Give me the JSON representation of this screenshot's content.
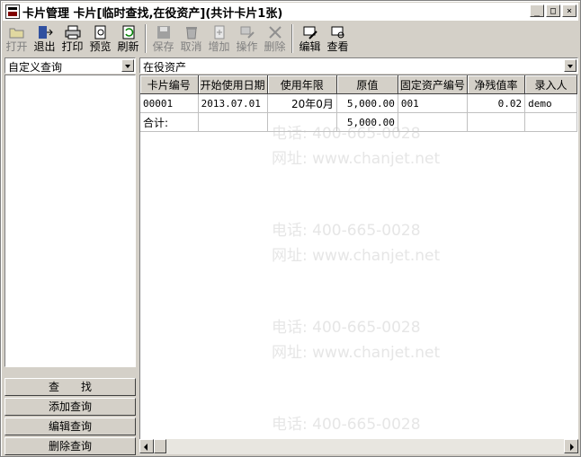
{
  "window": {
    "title": "卡片管理  卡片[临时查找,在役资产](共计卡片1张)",
    "min": "_",
    "max": "□",
    "close": "×"
  },
  "toolbar": [
    {
      "key": "open",
      "label": "打开",
      "enabled": false,
      "icon": "folder-open-icon"
    },
    {
      "key": "exit",
      "label": "退出",
      "enabled": true,
      "icon": "exit-door-icon"
    },
    {
      "key": "print",
      "label": "打印",
      "enabled": true,
      "icon": "printer-icon"
    },
    {
      "key": "preview",
      "label": "预览",
      "enabled": true,
      "icon": "print-preview-icon"
    },
    {
      "key": "refresh",
      "label": "刷新",
      "enabled": true,
      "icon": "refresh-icon"
    },
    {
      "key": "save",
      "label": "保存",
      "enabled": false,
      "icon": "floppy-icon"
    },
    {
      "key": "cancel",
      "label": "取消",
      "enabled": false,
      "icon": "trash-icon"
    },
    {
      "key": "add",
      "label": "增加",
      "enabled": false,
      "icon": "add-document-icon"
    },
    {
      "key": "operate",
      "label": "操作",
      "enabled": false,
      "icon": "operate-icon"
    },
    {
      "key": "delete",
      "label": "删除",
      "enabled": false,
      "icon": "delete-x-icon"
    },
    {
      "key": "edit",
      "label": "编辑",
      "enabled": true,
      "icon": "edit-icon"
    },
    {
      "key": "view",
      "label": "查看",
      "enabled": true,
      "icon": "view-icon"
    }
  ],
  "left": {
    "query_select": "自定义查询",
    "find_label": "查　　找",
    "add_query_label": "添加查询",
    "edit_query_label": "编辑查询",
    "delete_query_label": "删除查询"
  },
  "right": {
    "asset_select": "在役资产"
  },
  "table": {
    "headers": [
      "卡片编号",
      "开始使用日期",
      "使用年限",
      "原值",
      "固定资产编号",
      "净残值率",
      "录入人"
    ],
    "rows": [
      [
        "00001",
        "2013.07.01",
        "20年0月",
        "5,000.00",
        "001",
        "0.02",
        "demo"
      ]
    ],
    "total": {
      "label": "合计:",
      "value": "5,000.00"
    }
  },
  "watermark": {
    "phone": "电话: 400-665-0028",
    "site": "网址: www.chanjet.net"
  }
}
